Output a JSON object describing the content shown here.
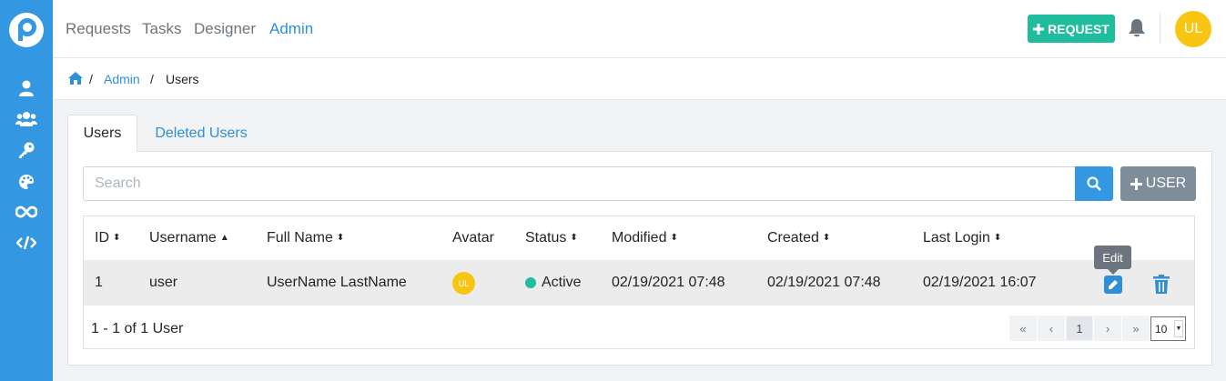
{
  "nav": {
    "items": [
      "Requests",
      "Tasks",
      "Designer",
      "Admin"
    ],
    "active": "Admin",
    "request_button": "REQUEST",
    "avatar_initials": "UL"
  },
  "sidebar": {
    "icons": [
      "user-icon",
      "users-icon",
      "key-icon",
      "palette-icon",
      "infinity-icon",
      "code-icon"
    ]
  },
  "breadcrumb": {
    "items": [
      "Admin",
      "Users"
    ]
  },
  "tabs": [
    "Users",
    "Deleted Users"
  ],
  "search": {
    "placeholder": "Search",
    "add_user_label": "USER"
  },
  "table": {
    "columns": [
      "ID",
      "Username",
      "Full Name",
      "Avatar",
      "Status",
      "Modified",
      "Created",
      "Last Login"
    ],
    "rows": [
      {
        "id": "1",
        "username": "user",
        "full_name": "UserName LastName",
        "avatar": "UL",
        "status": "Active",
        "modified": "02/19/2021 07:48",
        "created": "02/19/2021 07:48",
        "last_login": "02/19/2021 16:07"
      }
    ],
    "edit_tooltip": "Edit"
  },
  "pagination": {
    "summary": "1 - 1 of 1 User",
    "first": "«",
    "prev": "‹",
    "current": "1",
    "next": "›",
    "last": "»",
    "per_page": "10"
  },
  "colors": {
    "sidebar": "#3397e1",
    "accent": "#2f8fd6",
    "request_button": "#1fbd9e",
    "avatar": "#f9c513",
    "status_active": "#1fbd9e"
  }
}
